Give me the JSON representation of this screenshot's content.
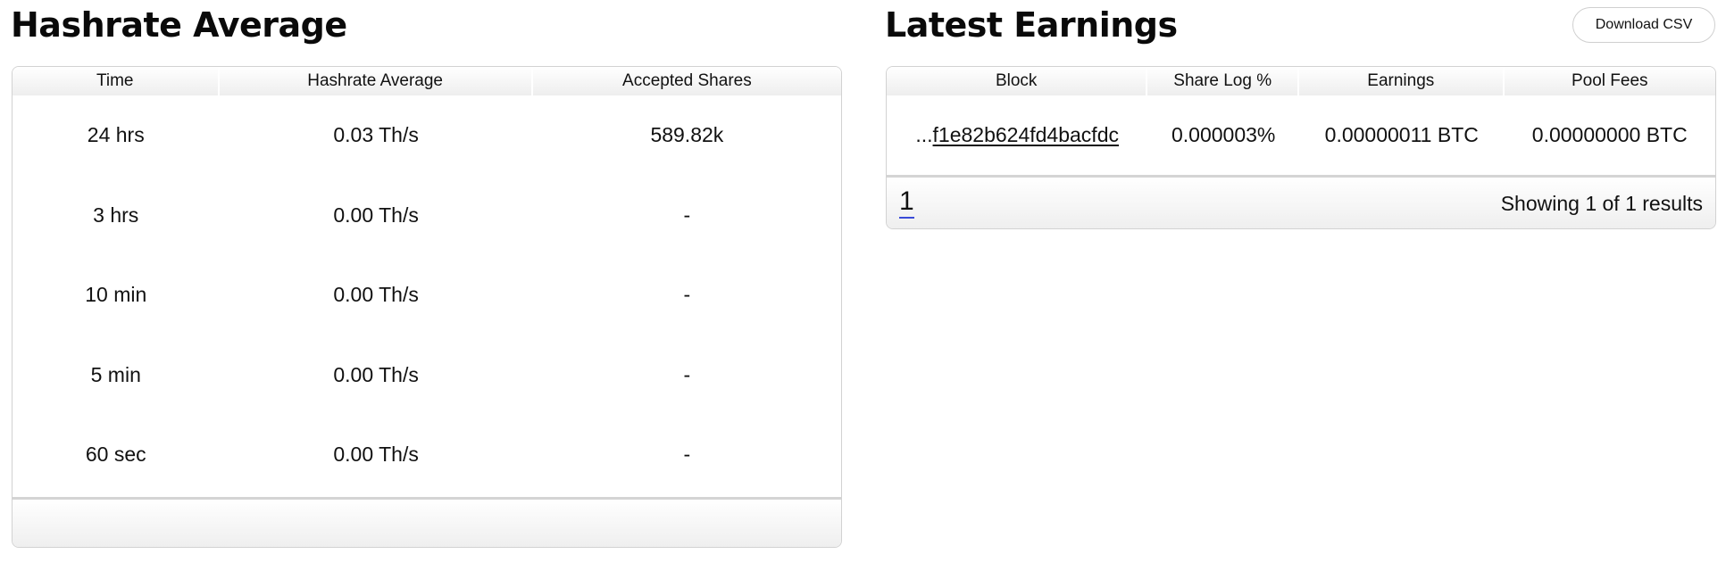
{
  "hashrate": {
    "title": "Hashrate Average",
    "columns": [
      "Time",
      "Hashrate Average",
      "Accepted Shares"
    ],
    "rows": [
      {
        "time": "24 hrs",
        "hashrate": "0.03 Th/s",
        "shares": "589.82k"
      },
      {
        "time": "3 hrs",
        "hashrate": "0.00 Th/s",
        "shares": "-"
      },
      {
        "time": "10 min",
        "hashrate": "0.00 Th/s",
        "shares": "-"
      },
      {
        "time": "5 min",
        "hashrate": "0.00 Th/s",
        "shares": "-"
      },
      {
        "time": "60 sec",
        "hashrate": "0.00 Th/s",
        "shares": "-"
      }
    ]
  },
  "earnings": {
    "title": "Latest Earnings",
    "download_label": "Download CSV",
    "columns": [
      "Block",
      "Share Log %",
      "Earnings",
      "Pool Fees"
    ],
    "rows": [
      {
        "block_prefix": "...",
        "block_hash": "f1e82b624fd4bacfdc",
        "share_log": "0.000003%",
        "earnings": "0.00000011 BTC",
        "pool_fees": "0.00000000 BTC"
      }
    ],
    "pagination": {
      "current_page": "1",
      "results_text": "Showing 1 of 1 results"
    }
  },
  "colors": {
    "pagination_underline": "#3a4bd8",
    "border": "#d2d2d2"
  }
}
